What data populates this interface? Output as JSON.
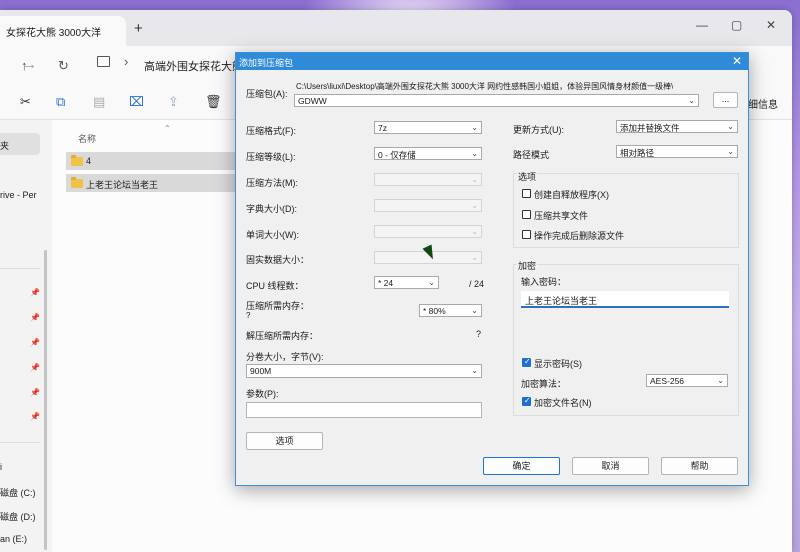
{
  "explorer": {
    "tab_title": "女探花大熊 3000大洋",
    "breadcrumb": "高端外围女探花大熊",
    "window_controls": [
      "—",
      "▢",
      "✕"
    ],
    "nav_icons": [
      "←",
      "→",
      "↑",
      "↻"
    ],
    "toolbar_more": "细信息",
    "sidebar": {
      "selected": "夹",
      "items": [
        "rive - Per"
      ],
      "drives": [
        "i",
        "磁盘 (C:)",
        "磁盘 (D:)",
        "an (E:)"
      ]
    },
    "column_name": "名称",
    "files": [
      "4",
      "上老王论坛当老王"
    ]
  },
  "dialog": {
    "title": "添加到压缩包",
    "close": "✕",
    "archive_label": "压缩包(A):",
    "archive_path": "C:\\Users\\liuxi\\Desktop\\高端外围女探花大熊 3000大洋 网约性感韩国小姐姐，体验异国风情身材颜值一级棒\\",
    "archive_name": "GDWW",
    "browse": "...",
    "format_label": "压缩格式(F):",
    "format_value": "7z",
    "level_label": "压缩等级(L):",
    "level_value": "0 - 仅存储",
    "method_label": "压缩方法(M):",
    "dict_label": "字典大小(D):",
    "word_label": "单词大小(W):",
    "solid_label": "固实数据大小：",
    "cpu_label": "CPU 线程数：",
    "cpu_value": "* 24",
    "cpu_total": "/ 24",
    "mem_label": "压缩所需内存：",
    "mem_q": "?",
    "mem_value": "* 80%",
    "decomp_label": "解压缩所需内存：",
    "decomp_q": "?",
    "split_label": "分卷大小，字节(V):",
    "split_value": "900M",
    "params_label": "参数(P):",
    "options_button": "选项",
    "update_label": "更新方式(U):",
    "update_value": "添加并替换文件",
    "path_label": "路径模式",
    "path_value": "相对路径",
    "options_group": "选项",
    "opt_sfx": "创建自释放程序(X)",
    "opt_shared": "压缩共享文件",
    "opt_delete": "操作完成后删除源文件",
    "encrypt_group": "加密",
    "pwd_label": "输入密码：",
    "pwd_value": "上老王论坛当老王",
    "show_pwd": "显示密码(S)",
    "enc_method_label": "加密算法：",
    "enc_method_value": "AES-256",
    "enc_names": "加密文件名(N)",
    "ok": "确定",
    "cancel": "取消",
    "help": "帮助"
  }
}
